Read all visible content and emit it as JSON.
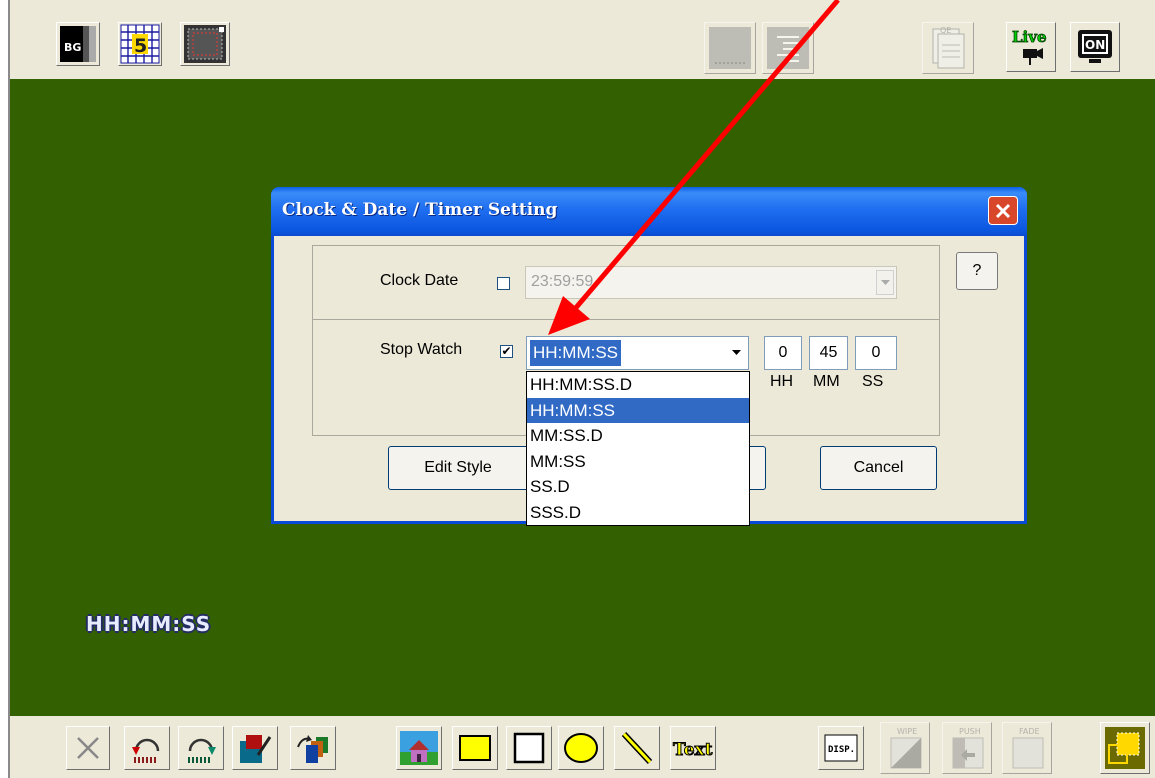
{
  "toolbar_top": {
    "left_icons": [
      "bg-icon",
      "grid-5-icon",
      "safe-area-icon"
    ],
    "bg_label": "BG",
    "grid_label": "5",
    "right_icons": [
      "preview-icon",
      "list-icon",
      "qe-icon",
      "live-camera-icon",
      "on-air-icon"
    ],
    "qe_label": "QE",
    "live_label": "Live",
    "on_label": "ON"
  },
  "stage": {
    "overlay_text": "HH:MM:SS"
  },
  "dialog": {
    "title": "Clock & Date / Timer  Setting",
    "help_label": "?",
    "clock_date": {
      "label": "Clock  Date",
      "checked": false,
      "value": "23:59:59"
    },
    "stop_watch": {
      "label": "Stop Watch",
      "checked": true,
      "check_mark": "✔",
      "format_value": "HH:MM:SS",
      "hh": "0",
      "mm": "45",
      "ss": "0",
      "hh_label": "HH",
      "mm_label": "MM",
      "ss_label": "SS"
    },
    "edit_style_label": "Edit Style",
    "cancel_label": "Cancel",
    "format_options": [
      "HH:MM:SS.D",
      "HH:MM:SS",
      "MM:SS.D",
      "MM:SS",
      "SS.D",
      "SSS.D"
    ],
    "selected_option": 1
  },
  "toolbar_bottom": {
    "icons": [
      "delete-icon",
      "undo-icon",
      "redo-icon",
      "edit-icon",
      "layers-icon",
      "image-icon",
      "rectangle-icon",
      "ellipse-icon",
      "line-icon",
      "text-tool-icon",
      "disp-icon",
      "wipe-icon",
      "push-icon",
      "fade-icon",
      "transition-icon"
    ],
    "text_label": "Text",
    "disp_label": "DISP.",
    "wipe_label": "WIPE",
    "push_label": "PUSH",
    "fade_label": "FADE"
  },
  "colors": {
    "stage_bg": "#336000",
    "titlebar": "#0b55de",
    "selection": "#316ac5",
    "annotation_arrow": "#ff0000"
  }
}
